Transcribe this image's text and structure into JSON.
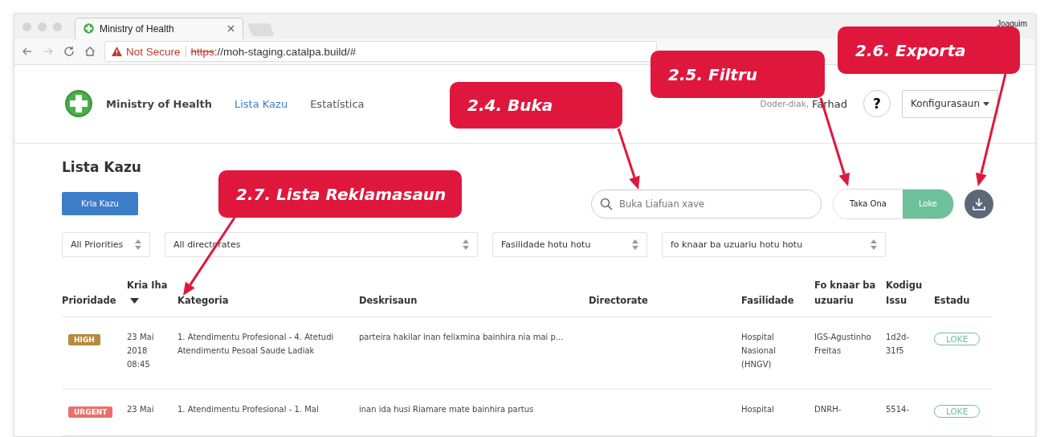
{
  "browser": {
    "tab_title": "Ministry of Health",
    "security": "Not Secure",
    "url_scheme": "https",
    "url_rest": "://moh-staging.catalpa.build/#",
    "profile": "Joaquim"
  },
  "header": {
    "brand": "Ministry of Health",
    "nav": [
      {
        "label": "Lista Kazu",
        "selected": true
      },
      {
        "label": "Estatística",
        "selected": false
      }
    ],
    "greeting": "Doder-diak,",
    "user": "Farhad",
    "help": "?",
    "settings": "Konfigurasaun"
  },
  "page": {
    "title": "Lista Kazu",
    "create_button": "Kria Kazu",
    "search": {
      "placeholder": "Buka Liafuan xave"
    },
    "status_toggle": [
      {
        "label": "Taka Ona",
        "selected": false
      },
      {
        "label": "Loke",
        "selected": true
      }
    ]
  },
  "filters": [
    {
      "value": "All Priorities"
    },
    {
      "value": "All directorates"
    },
    {
      "value": "Fasilidade hotu hotu"
    },
    {
      "value": "fo knaar ba uzuariu hotu hotu"
    }
  ],
  "table": {
    "columns": [
      {
        "label": "Prioridade",
        "sorted": false
      },
      {
        "label": "Kria Iha",
        "sorted": true
      },
      {
        "label": "Kategoria",
        "sorted": false
      },
      {
        "label": "Deskrisaun",
        "sorted": false
      },
      {
        "label": "Directorate",
        "sorted": false
      },
      {
        "label": "Fasilidade",
        "sorted": false
      },
      {
        "label": "Fo knaar ba uzuariu",
        "sorted": false
      },
      {
        "label": "Kodigu Issu",
        "sorted": false
      },
      {
        "label": "Estadu",
        "sorted": false
      }
    ],
    "rows": [
      {
        "priority": {
          "label": "HIGH",
          "color": "#b8893f"
        },
        "created": "23 Mai 2018 08:45",
        "category": "1. Atendimentu Profesional - 4. Atetudi Atendimentu Pesoal Saude Ladiak",
        "description": "parteira hakilar inan felixmina bainhira nia mai p...",
        "facility": "Hospital Nasional (HNGV)",
        "assignee": "IGS-Agustinho Freitas",
        "code": "1d2d-31f5",
        "status": "LOKE"
      },
      {
        "priority": {
          "label": "URGENT",
          "color": "#e9706a"
        },
        "created": "23 Mai",
        "category": "1. Atendimentu Profesional - 1. Mal",
        "description": "inan ida husi Riamare mate bainhira partus",
        "facility": "Hospital",
        "assignee": "DNRH-",
        "code": "5514-",
        "status": "LOKE"
      }
    ]
  },
  "callouts": [
    {
      "label": "2.4. Buka"
    },
    {
      "label": "2.5. Filtru"
    },
    {
      "label": "2.6. Exporta"
    },
    {
      "label": "2.7. Lista Reklamasaun"
    }
  ]
}
